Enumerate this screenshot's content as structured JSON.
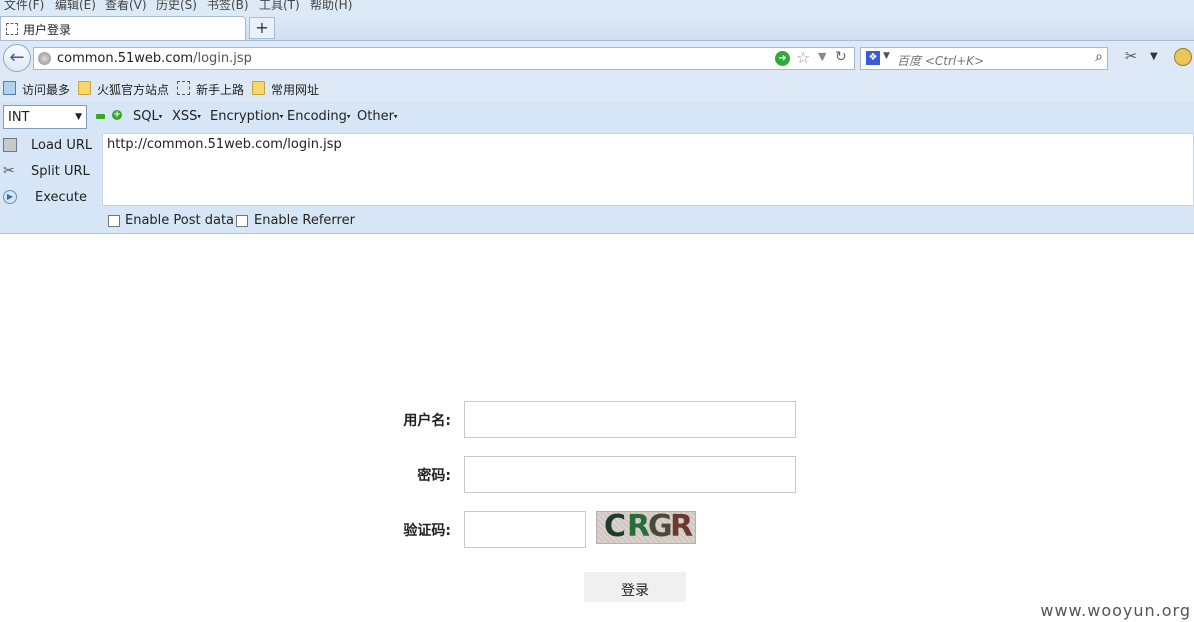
{
  "menu": [
    "文件(F)",
    "编辑(E)",
    "查看(V)",
    "历史(S)",
    "书签(B)",
    "工具(T)",
    "帮助(H)"
  ],
  "tab": {
    "title": "用户登录",
    "new_tab_label": "+"
  },
  "navbar": {
    "url_host": "common.51web.com",
    "url_path": "/login.jsp",
    "search_placeholder": "百度 <Ctrl+K>"
  },
  "bookmarks": [
    "访问最多",
    "火狐官方站点",
    "新手上路",
    "常用网址"
  ],
  "hackbar": {
    "select_value": "INT",
    "menus": [
      "SQL",
      "XSS",
      "Encryption",
      "Encoding",
      "Other"
    ],
    "buttons": {
      "load": "Load URL",
      "split": "Split URL",
      "execute": "Execute"
    },
    "url_value": "http://common.51web.com/login.jsp",
    "enable_post": "Enable Post data",
    "enable_referrer": "Enable Referrer"
  },
  "form": {
    "username_label": "用户名:",
    "password_label": "密码:",
    "captcha_label": "验证码:",
    "captcha_letters": [
      "C",
      "R",
      "G",
      "R"
    ],
    "captcha_colors": [
      "#1f3a2f",
      "#2a6b3c",
      "#4a4a3a",
      "#6b3a2a"
    ],
    "login_button": "登录"
  },
  "watermark": "www.wooyun.org"
}
